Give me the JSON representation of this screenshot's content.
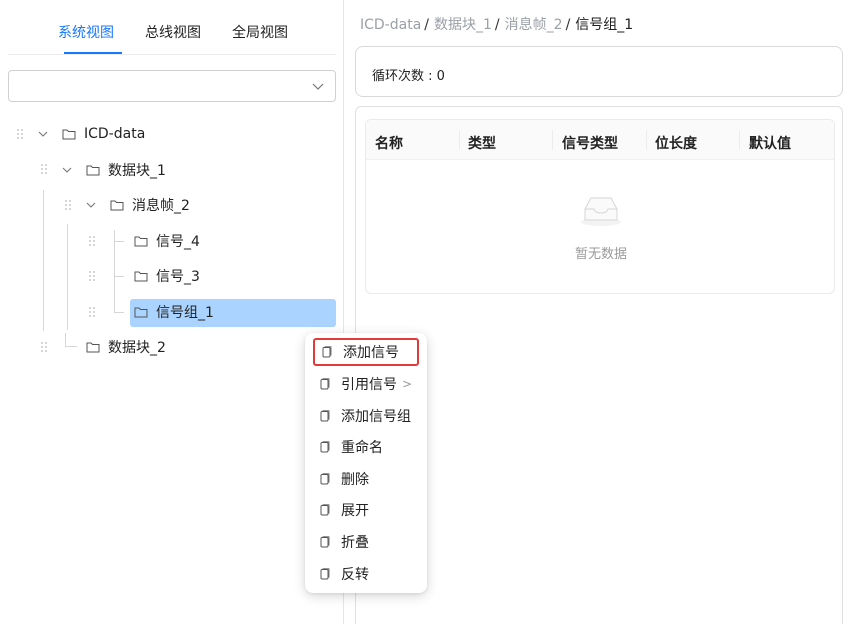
{
  "left_panel": {
    "tabs": [
      {
        "label": "系统视图",
        "active": true
      },
      {
        "label": "总线视图",
        "active": false
      },
      {
        "label": "全局视图",
        "active": false
      }
    ],
    "select": {
      "value": ""
    },
    "tree": [
      {
        "label": "ICD-data",
        "expanded": true
      },
      {
        "label": "数据块_1",
        "expanded": true
      },
      {
        "label": "消息帧_2",
        "expanded": true
      },
      {
        "label": "信号_4"
      },
      {
        "label": "信号_3"
      },
      {
        "label": "信号组_1",
        "selected": true
      },
      {
        "label": "数据块_2"
      }
    ]
  },
  "breadcrumb": [
    {
      "label": "ICD-data"
    },
    {
      "label": "数据块_1"
    },
    {
      "label": "消息帧_2"
    },
    {
      "label": "信号组_1"
    }
  ],
  "loop": {
    "label": "循环次数 : 0"
  },
  "table": {
    "columns": [
      "名称",
      "类型",
      "信号类型",
      "位长度",
      "默认值"
    ],
    "rows": [],
    "empty_text": "暂无数据"
  },
  "context_menu": {
    "items": [
      {
        "label": "添加信号",
        "highlighted": true
      },
      {
        "label": "引用信号",
        "submenu_arrow": ">"
      },
      {
        "label": "添加信号组"
      },
      {
        "label": "重命名"
      },
      {
        "label": "删除"
      },
      {
        "label": "展开"
      },
      {
        "label": "折叠"
      },
      {
        "label": "反转"
      }
    ]
  },
  "colors": {
    "accent": "#1677ff",
    "selected_node_bg": "#aad4ff",
    "highlight_border": "#e33b3b",
    "empty_text": "#9a9a9a"
  },
  "icons": {
    "tree_node": "folder-icon",
    "drag_handle": "drag-handle-icon",
    "menu_item": "copy-icon",
    "select": "chevron-down-icon",
    "empty": "inbox-icon"
  }
}
